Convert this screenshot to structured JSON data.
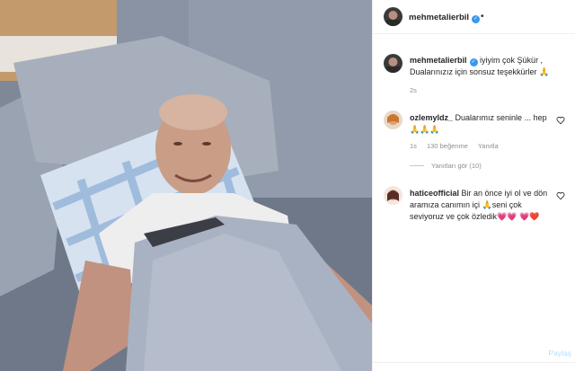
{
  "post": {
    "author": "mehmetalierbil",
    "header_dot": "•",
    "caption_username": "mehmetalierbil",
    "caption_text": "iyiyim çok Şükür , Dualarınızız için sonsuz teşekkürler 🙏",
    "caption_time": "2s",
    "view_replies": "Yanıtları gör (10)",
    "share": "Paylaş"
  },
  "comments": [
    {
      "username": "ozlemyldz_",
      "text": "Dualarımız seninle ... hep 🙏🙏🙏",
      "time": "1s",
      "likes": "130 beğenme",
      "reply": "Yanıtla"
    },
    {
      "username": "haticeofficial",
      "text": "Bir an önce iyi ol ve dön aramıza canımın içi 🙏seni çok seviyoruz ve çok özledik💗💗 💗❤️"
    }
  ],
  "icons": {
    "verified": "verified-badge-icon",
    "like": "heart-outline-icon"
  },
  "colors": {
    "verified_blue": "#3897f0",
    "share_link": "#b2dffc",
    "secondary_text": "#8e8e8e"
  }
}
